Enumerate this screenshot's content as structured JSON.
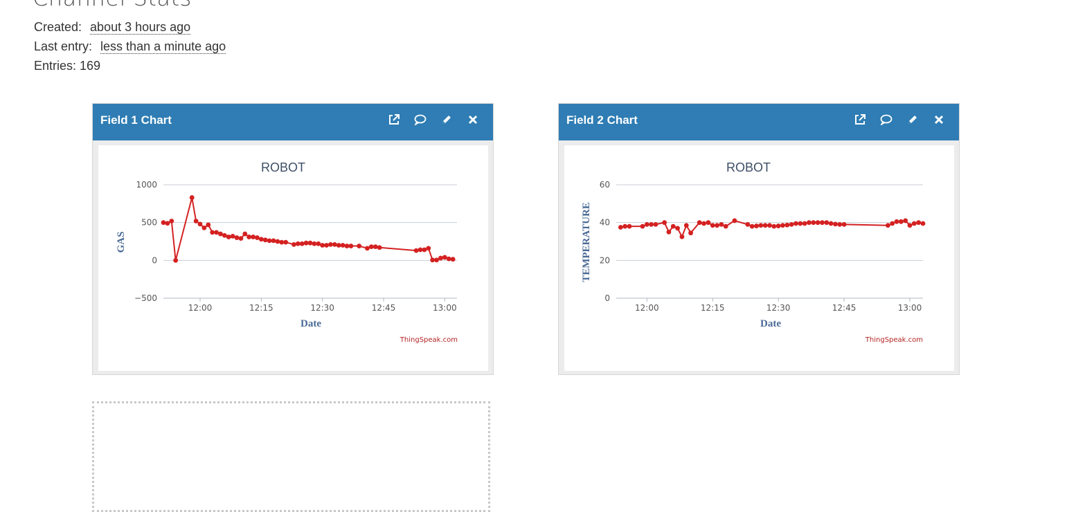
{
  "page": {
    "title": "Channel Stats"
  },
  "stats": {
    "created_label": "Created:",
    "created_value": "about 3 hours ago",
    "last_entry_label": "Last entry:",
    "last_entry_value": "less than a minute ago",
    "entries_text": "Entries: 169"
  },
  "panels": [
    {
      "title": "Field 1 Chart",
      "icons": [
        "external-link-icon",
        "comment-icon",
        "pencil-icon",
        "close-icon"
      ]
    },
    {
      "title": "Field 2 Chart",
      "icons": [
        "external-link-icon",
        "comment-icon",
        "pencil-icon",
        "close-icon"
      ]
    }
  ],
  "colors": {
    "header": "#2f7db4",
    "line": "#d42121",
    "grid": "#c8cdd5"
  },
  "chart_data": [
    {
      "type": "line",
      "title": "ROBOT",
      "xlabel": "Date",
      "ylabel": "GAS",
      "credit": "ThingSpeak.com",
      "ylim": [
        -500,
        1000
      ],
      "yticks": [
        "1000",
        "500",
        "0",
        "−500"
      ],
      "ytick_values": [
        1000,
        500,
        0,
        -500
      ],
      "xlim": [
        "11:51",
        "13:03"
      ],
      "xticks": [
        "12:00",
        "12:15",
        "12:30",
        "12:45",
        "13:00"
      ],
      "grid": true,
      "series": [
        {
          "x": [
            "11:51",
            "11:52",
            "11:53",
            "11:54",
            "11:58",
            "11:59",
            "12:00",
            "12:01",
            "12:02",
            "12:03",
            "12:04",
            "12:05",
            "12:06",
            "12:07",
            "12:08",
            "12:09",
            "12:10",
            "12:11",
            "12:12",
            "12:13",
            "12:14",
            "12:15",
            "12:16",
            "12:17",
            "12:18",
            "12:19",
            "12:20",
            "12:21",
            "12:23",
            "12:24",
            "12:25",
            "12:26",
            "12:27",
            "12:28",
            "12:29",
            "12:30",
            "12:31",
            "12:32",
            "12:33",
            "12:34",
            "12:35",
            "12:36",
            "12:37",
            "12:39",
            "12:41",
            "12:42",
            "12:43",
            "12:44",
            "12:53",
            "12:54",
            "12:55",
            "12:56",
            "12:57",
            "12:58",
            "12:59",
            "13:00",
            "13:01",
            "13:02"
          ],
          "y": [
            500,
            490,
            520,
            0,
            830,
            520,
            480,
            430,
            470,
            370,
            370,
            350,
            330,
            310,
            320,
            300,
            290,
            350,
            310,
            310,
            300,
            280,
            270,
            260,
            260,
            250,
            240,
            240,
            210,
            220,
            220,
            230,
            230,
            220,
            220,
            200,
            200,
            210,
            210,
            200,
            200,
            190,
            190,
            190,
            160,
            180,
            180,
            170,
            130,
            140,
            140,
            160,
            5,
            5,
            30,
            40,
            20,
            15
          ]
        }
      ]
    },
    {
      "type": "line",
      "title": "ROBOT",
      "xlabel": "Date",
      "ylabel": "TEMPERATURE",
      "credit": "ThingSpeak.com",
      "ylim": [
        0,
        60
      ],
      "yticks": [
        "60",
        "40",
        "20",
        "0"
      ],
      "ytick_values": [
        60,
        40,
        20,
        0
      ],
      "xlim": [
        "11:53",
        "13:03"
      ],
      "xticks": [
        "12:00",
        "12:15",
        "12:30",
        "12:45",
        "13:00"
      ],
      "grid": true,
      "series": [
        {
          "x": [
            "11:54",
            "11:55",
            "11:56",
            "11:59",
            "12:00",
            "12:01",
            "12:02",
            "12:04",
            "12:05",
            "12:06",
            "12:07",
            "12:08",
            "12:09",
            "12:10",
            "12:12",
            "12:13",
            "12:14",
            "12:15",
            "12:16",
            "12:17",
            "12:18",
            "12:20",
            "12:23",
            "12:24",
            "12:25",
            "12:26",
            "12:27",
            "12:28",
            "12:29",
            "12:30",
            "12:31",
            "12:32",
            "12:33",
            "12:34",
            "12:35",
            "12:36",
            "12:37",
            "12:38",
            "12:39",
            "12:40",
            "12:41",
            "12:42",
            "12:43",
            "12:44",
            "12:45",
            "12:55",
            "12:56",
            "12:57",
            "12:58",
            "12:59",
            "13:00",
            "13:01",
            "13:02",
            "13:03"
          ],
          "y": [
            37.5,
            38,
            38,
            38,
            39,
            39,
            39,
            40,
            35,
            38,
            37,
            32.5,
            38.5,
            34.5,
            40,
            39.5,
            40,
            38.5,
            38.5,
            39,
            38,
            41,
            39,
            38,
            38.2,
            38.5,
            38.5,
            38.5,
            38,
            38.2,
            38.5,
            38.7,
            39,
            39.5,
            39.5,
            39.5,
            40,
            40,
            40,
            40,
            40,
            39.5,
            39.2,
            39,
            39,
            38.5,
            39.5,
            40.5,
            40.5,
            41,
            38.5,
            39.5,
            40,
            39.5
          ]
        }
      ]
    }
  ]
}
